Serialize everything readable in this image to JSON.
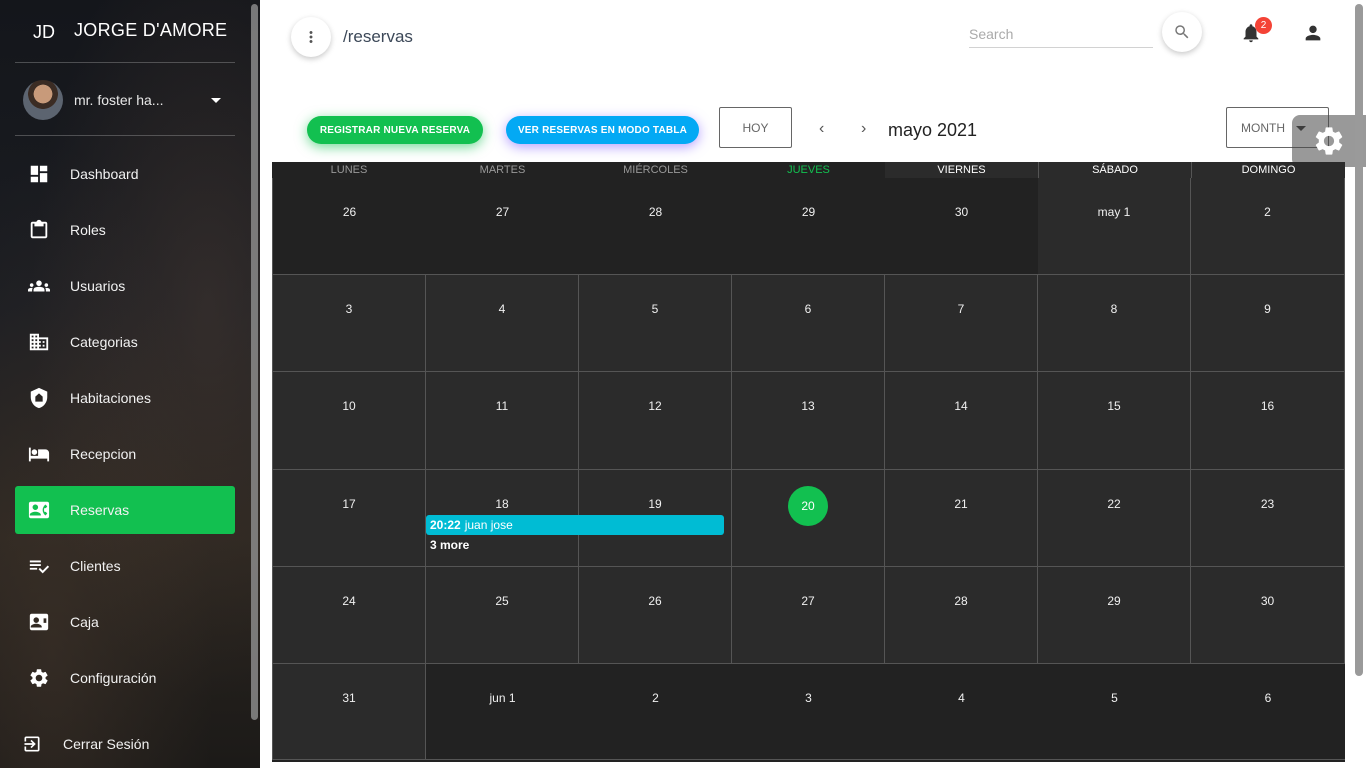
{
  "sidebar": {
    "brand_mini": "JD",
    "brand_name": "JORGE D'AMORE",
    "user_name": "mr. foster ha...",
    "items": [
      {
        "label": "Dashboard",
        "icon": "dashboard-icon"
      },
      {
        "label": "Roles",
        "icon": "clipboard-icon"
      },
      {
        "label": "Usuarios",
        "icon": "group-icon"
      },
      {
        "label": "Categorias",
        "icon": "building-icon"
      },
      {
        "label": "Habitaciones",
        "icon": "shield-icon"
      },
      {
        "label": "Recepcion",
        "icon": "bed-icon"
      },
      {
        "label": "Reservas",
        "icon": "contact-card-icon",
        "active": true
      },
      {
        "label": "Clientes",
        "icon": "person-list-icon"
      },
      {
        "label": "Caja",
        "icon": "cash-register-icon"
      },
      {
        "label": "Configuración",
        "icon": "settings-icon"
      }
    ],
    "logout_label": "Cerrar Sesión"
  },
  "topbar": {
    "route": "/reservas",
    "search_placeholder": "Search",
    "notification_count": "2"
  },
  "toolbar": {
    "new_reservation": "REGISTRAR NUEVA RESERVA",
    "table_view": "VER RESERVAS EN MODO TABLA",
    "today": "HOY",
    "prev": "‹",
    "next": "›",
    "month_title": "mayo 2021",
    "view_mode": "MONTH"
  },
  "calendar": {
    "weekdays": [
      "LUNES",
      "MARTES",
      "MIÉRCOLES",
      "JUEVES",
      "VIERNES",
      "SÁBADO",
      "DOMINGO"
    ],
    "today_weekday_index": 3,
    "weeks": [
      [
        "26",
        "27",
        "28",
        "29",
        "30",
        "may 1",
        "2"
      ],
      [
        "3",
        "4",
        "5",
        "6",
        "7",
        "8",
        "9"
      ],
      [
        "10",
        "11",
        "12",
        "13",
        "14",
        "15",
        "16"
      ],
      [
        "17",
        "18",
        "19",
        "20",
        "21",
        "22",
        "23"
      ],
      [
        "24",
        "25",
        "26",
        "27",
        "28",
        "29",
        "30"
      ],
      [
        "31",
        "jun 1",
        "2",
        "3",
        "4",
        "5",
        "6"
      ]
    ],
    "today": "20",
    "event": {
      "time": "20:22",
      "title": "juan jose"
    },
    "more_label": "3 more"
  },
  "colors": {
    "accent_green": "#12c050",
    "accent_blue": "#03a9f4",
    "event_cyan": "#00bcd4",
    "badge_red": "#f44336"
  }
}
